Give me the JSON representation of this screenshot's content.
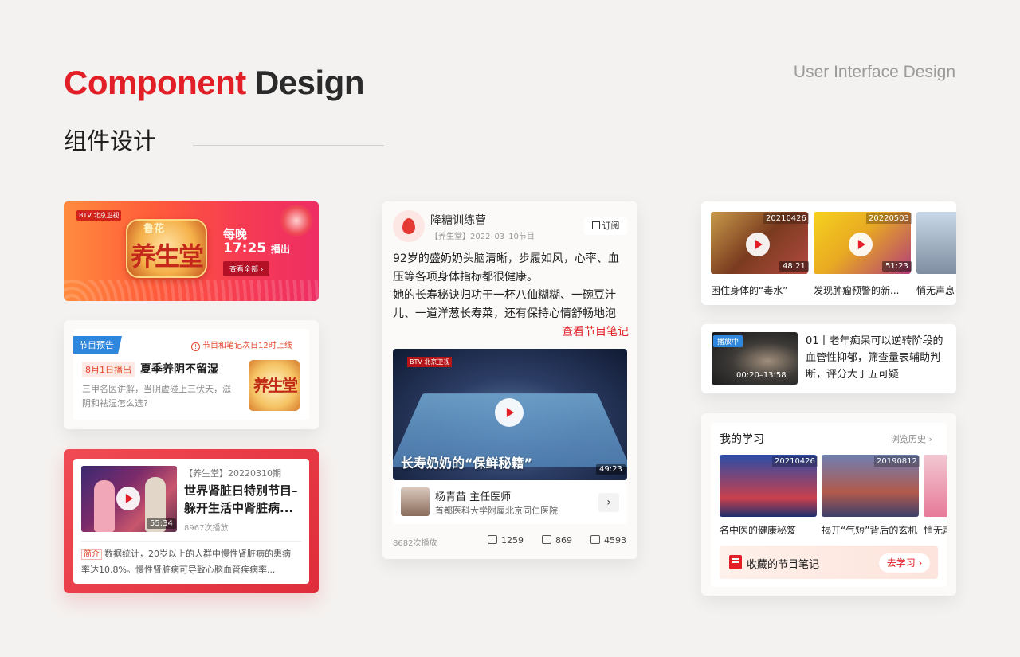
{
  "header": {
    "title_red": "Component",
    "title_dark": "Design",
    "subtitle_en": "User Interface Design",
    "subtitle_cn": "组件设计"
  },
  "banner": {
    "channel": "BTV 北京卫视",
    "logo_top": "鲁花",
    "logo_main": "养生堂",
    "line1": "每晚",
    "time": "17:25",
    "time_suffix": "播出",
    "view_all": "查看全部 ›"
  },
  "preview": {
    "tag": "节目预告",
    "notice_icon": "!",
    "notice": "节目和笔记次日12时上线",
    "date": "8月1日播出",
    "title": "夏季养阴不留湿",
    "desc": "三甲名医讲解，当阴虚碰上三伏天，滋阴和祛湿怎么选?",
    "thumb_text": "养生堂"
  },
  "video_item": {
    "source": "【养生堂】20220310期",
    "title": "世界肾脏日特别节目–躲开生活中肾脏病...",
    "views": "8967次播放",
    "duration": "55:34",
    "tag": "简介",
    "desc": "数据统计，20岁以上的人群中慢性肾脏病的患病率达10.8%。慢性肾脏病可导致心脑血管疾病率..."
  },
  "post": {
    "author": "降糖训练营",
    "meta": "【养生堂】2022–03–10节目",
    "subscribe": "订阅",
    "text": "92岁的盛奶奶头脑清晰，步履如风，心率、血压等各项身体指标都很健康。\n她的长寿秘诀归功于一杯八仙糊糊、一碗豆汁儿、一道洋葱长寿菜，还有保持心情舒畅地泡脚。这些都是一样东西带",
    "more": "查看节目笔记",
    "video_channel": "BTV 北京卫视",
    "video_caption": "长寿奶奶的“保鲜秘籍”",
    "video_duration": "49:23",
    "doctor_name": "杨青苗 主任医师",
    "doctor_org": "首都医科大学附属北京同仁医院",
    "plays": "8682次播放",
    "shares": "1259",
    "comments": "869",
    "likes": "4593"
  },
  "recent": {
    "items": [
      {
        "date": "20210426",
        "duration": "48:21",
        "caption": "困住身体的“毒水”"
      },
      {
        "date": "20220503",
        "duration": "51:23",
        "caption": "发现肿瘤预警的新..."
      },
      {
        "date": "",
        "duration": "",
        "caption": "悄无声息"
      }
    ]
  },
  "now_playing": {
    "badge": "播放中",
    "time": "00:20–13:58",
    "title": "01丨老年痴呆可以逆转阶段的血管性抑郁，筛查量表辅助判断，评分大于五可疑"
  },
  "learning": {
    "title": "我的学习",
    "history": "浏览历史 ›",
    "items": [
      {
        "date": "20210426",
        "caption": "名中医的健康秘笈"
      },
      {
        "date": "20190812",
        "caption": "揭开“气短”背后的玄机"
      },
      {
        "date": "",
        "caption": "悄无声"
      }
    ],
    "notes_label": "收藏的节目笔记",
    "go_learn": "去学习 ›"
  },
  "colors": {
    "brand_red": "#e21f26",
    "accent_blue": "#2f86dd"
  }
}
